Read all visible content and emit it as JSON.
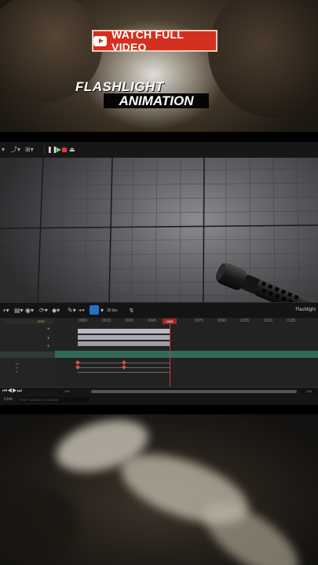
{
  "overlay": {
    "badge_label": "WATCH FULL VIDEO",
    "title_line1": "FLASHLIGHT",
    "title_line2": "ANIMATION"
  },
  "editor": {
    "sequencer": {
      "fps_label": "30 fps",
      "sequence_name": "Flashlight",
      "playhead_frame": "0068",
      "start_frame": "0000",
      "range_start": "-015",
      "range_end": "-015",
      "ruler_ticks": [
        "0000",
        "0015",
        "0030",
        "0045",
        "0068",
        "0075",
        "0090",
        "0105",
        "0120",
        "0135"
      ]
    },
    "console": {
      "label": "Cmd",
      "placeholder": "Enter Console Command"
    }
  },
  "colors": {
    "badge_red": "#d4301f",
    "track_green": "#2f6b58",
    "playhead_red": "#d23a3a",
    "toolbar_blue": "#1f73c9"
  },
  "icons": [
    "youtube-play-icon",
    "pause-icon",
    "record-icon",
    "eject-icon",
    "magnet-icon",
    "key-icon",
    "add-track-icon"
  ]
}
